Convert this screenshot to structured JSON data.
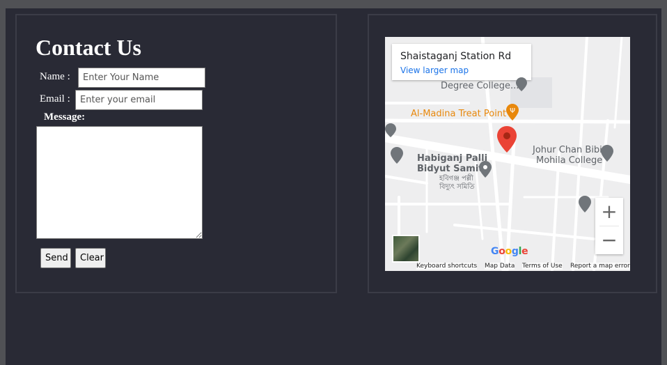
{
  "contact": {
    "title": "Contact Us",
    "name_label": "Name :",
    "name_placeholder": "Enter Your Name",
    "email_label": "Email :",
    "email_placeholder": "Enter your email",
    "message_label": "Message:",
    "send_label": "Send",
    "clear_label": "Clear"
  },
  "map": {
    "place_title": "Shaistaganj Station Rd",
    "view_larger": "View larger map",
    "labels": {
      "degree_college": "Degree College...",
      "al_madina": "Al-Madina Treat Point",
      "habiganj_1": "Habiganj Palli",
      "habiganj_2": "Bidyut Samity",
      "bengali_1": "হবিগঞ্জ পল্লী",
      "bengali_2": "বিদ্যুৎ সমিতি",
      "johur_1": "Johur Chan Bibi",
      "johur_2": "Mohila College"
    },
    "zoom_in": "+",
    "zoom_out": "−",
    "google": "Google",
    "attribution": {
      "shortcuts": "Keyboard shortcuts",
      "map_data": "Map Data",
      "terms": "Terms of Use",
      "report": "Report a map error"
    }
  },
  "colors": {
    "background": "#292a35",
    "link": "#1a73e8",
    "marker": "#ea4335",
    "food_label": "#e8880c"
  }
}
